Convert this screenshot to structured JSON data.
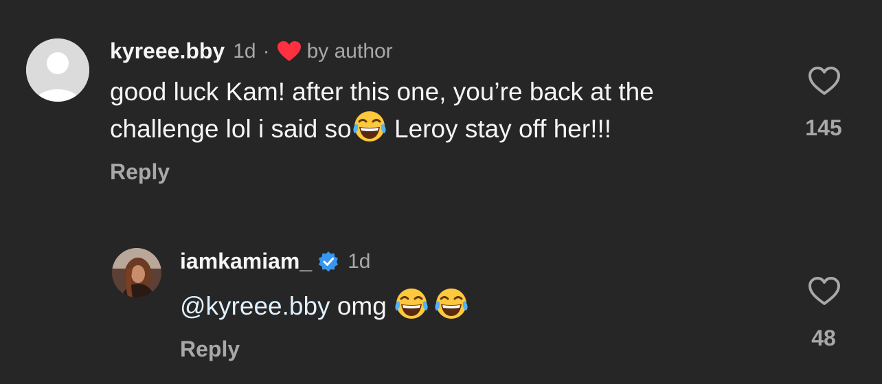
{
  "comments": [
    {
      "username": "kyreee.bby",
      "time": "1d",
      "separator": "·",
      "author_badge": "by author",
      "text_line1": "good luck Kam! after this one, you’re back at the",
      "text_line2a": "challenge lol i said so",
      "text_line2b": " Leroy stay off her!!!",
      "reply_label": "Reply",
      "like_count": "145",
      "avatar": "default-avatar",
      "liked_by_author_icon": "heart-icon",
      "heart_color": "#ff3040"
    },
    {
      "username": "iamkamiam_",
      "verified_icon": "verified-badge-icon",
      "verified_color": "#3797f0",
      "time": "1d",
      "mention": "@kyreee.bby",
      "text_rest": " omg ",
      "reply_label": "Reply",
      "like_count": "48",
      "avatar": "profile-photo"
    }
  ],
  "emoji": "face-with-tears-of-joy"
}
